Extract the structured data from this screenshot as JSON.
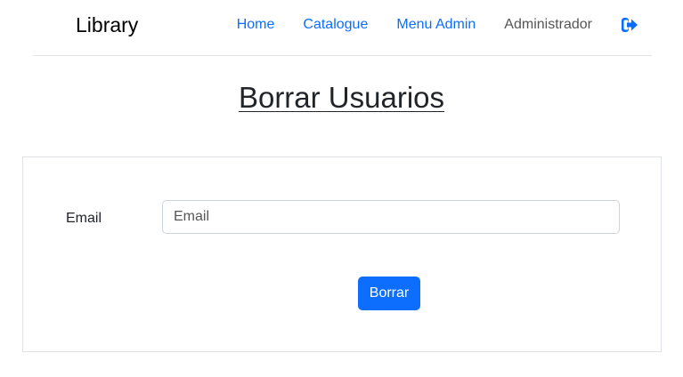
{
  "navbar": {
    "brand": "Library",
    "links": [
      {
        "label": "Home"
      },
      {
        "label": "Catalogue"
      },
      {
        "label": "Menu Admin"
      }
    ],
    "user": "Administrador",
    "logout_icon": "logout-icon"
  },
  "page": {
    "title": "Borrar Usuarios"
  },
  "form": {
    "email_label": "Email",
    "email_placeholder": "Email",
    "email_value": "",
    "submit_label": "Borrar"
  },
  "colors": {
    "accent": "#0d6efd",
    "text": "#212529",
    "border": "#dee2e6"
  }
}
